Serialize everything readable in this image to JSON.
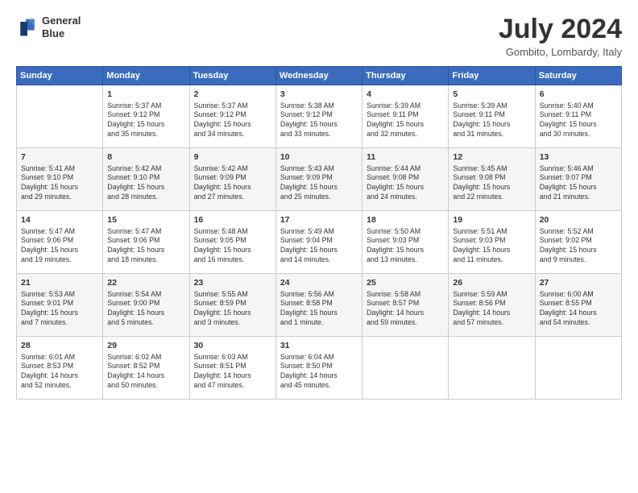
{
  "header": {
    "logo_line1": "General",
    "logo_line2": "Blue",
    "month_year": "July 2024",
    "location": "Gombito, Lombardy, Italy"
  },
  "weekdays": [
    "Sunday",
    "Monday",
    "Tuesday",
    "Wednesday",
    "Thursday",
    "Friday",
    "Saturday"
  ],
  "weeks": [
    [
      {
        "day": "",
        "info": ""
      },
      {
        "day": "1",
        "info": "Sunrise: 5:37 AM\nSunset: 9:12 PM\nDaylight: 15 hours\nand 35 minutes."
      },
      {
        "day": "2",
        "info": "Sunrise: 5:37 AM\nSunset: 9:12 PM\nDaylight: 15 hours\nand 34 minutes."
      },
      {
        "day": "3",
        "info": "Sunrise: 5:38 AM\nSunset: 9:12 PM\nDaylight: 15 hours\nand 33 minutes."
      },
      {
        "day": "4",
        "info": "Sunrise: 5:39 AM\nSunset: 9:11 PM\nDaylight: 15 hours\nand 32 minutes."
      },
      {
        "day": "5",
        "info": "Sunrise: 5:39 AM\nSunset: 9:11 PM\nDaylight: 15 hours\nand 31 minutes."
      },
      {
        "day": "6",
        "info": "Sunrise: 5:40 AM\nSunset: 9:11 PM\nDaylight: 15 hours\nand 30 minutes."
      }
    ],
    [
      {
        "day": "7",
        "info": "Sunrise: 5:41 AM\nSunset: 9:10 PM\nDaylight: 15 hours\nand 29 minutes."
      },
      {
        "day": "8",
        "info": "Sunrise: 5:42 AM\nSunset: 9:10 PM\nDaylight: 15 hours\nand 28 minutes."
      },
      {
        "day": "9",
        "info": "Sunrise: 5:42 AM\nSunset: 9:09 PM\nDaylight: 15 hours\nand 27 minutes."
      },
      {
        "day": "10",
        "info": "Sunrise: 5:43 AM\nSunset: 9:09 PM\nDaylight: 15 hours\nand 25 minutes."
      },
      {
        "day": "11",
        "info": "Sunrise: 5:44 AM\nSunset: 9:08 PM\nDaylight: 15 hours\nand 24 minutes."
      },
      {
        "day": "12",
        "info": "Sunrise: 5:45 AM\nSunset: 9:08 PM\nDaylight: 15 hours\nand 22 minutes."
      },
      {
        "day": "13",
        "info": "Sunrise: 5:46 AM\nSunset: 9:07 PM\nDaylight: 15 hours\nand 21 minutes."
      }
    ],
    [
      {
        "day": "14",
        "info": "Sunrise: 5:47 AM\nSunset: 9:06 PM\nDaylight: 15 hours\nand 19 minutes."
      },
      {
        "day": "15",
        "info": "Sunrise: 5:47 AM\nSunset: 9:06 PM\nDaylight: 15 hours\nand 18 minutes."
      },
      {
        "day": "16",
        "info": "Sunrise: 5:48 AM\nSunset: 9:05 PM\nDaylight: 15 hours\nand 16 minutes."
      },
      {
        "day": "17",
        "info": "Sunrise: 5:49 AM\nSunset: 9:04 PM\nDaylight: 15 hours\nand 14 minutes."
      },
      {
        "day": "18",
        "info": "Sunrise: 5:50 AM\nSunset: 9:03 PM\nDaylight: 15 hours\nand 13 minutes."
      },
      {
        "day": "19",
        "info": "Sunrise: 5:51 AM\nSunset: 9:03 PM\nDaylight: 15 hours\nand 11 minutes."
      },
      {
        "day": "20",
        "info": "Sunrise: 5:52 AM\nSunset: 9:02 PM\nDaylight: 15 hours\nand 9 minutes."
      }
    ],
    [
      {
        "day": "21",
        "info": "Sunrise: 5:53 AM\nSunset: 9:01 PM\nDaylight: 15 hours\nand 7 minutes."
      },
      {
        "day": "22",
        "info": "Sunrise: 5:54 AM\nSunset: 9:00 PM\nDaylight: 15 hours\nand 5 minutes."
      },
      {
        "day": "23",
        "info": "Sunrise: 5:55 AM\nSunset: 8:59 PM\nDaylight: 15 hours\nand 3 minutes."
      },
      {
        "day": "24",
        "info": "Sunrise: 5:56 AM\nSunset: 8:58 PM\nDaylight: 15 hours\nand 1 minute."
      },
      {
        "day": "25",
        "info": "Sunrise: 5:58 AM\nSunset: 8:57 PM\nDaylight: 14 hours\nand 59 minutes."
      },
      {
        "day": "26",
        "info": "Sunrise: 5:59 AM\nSunset: 8:56 PM\nDaylight: 14 hours\nand 57 minutes."
      },
      {
        "day": "27",
        "info": "Sunrise: 6:00 AM\nSunset: 8:55 PM\nDaylight: 14 hours\nand 54 minutes."
      }
    ],
    [
      {
        "day": "28",
        "info": "Sunrise: 6:01 AM\nSunset: 8:53 PM\nDaylight: 14 hours\nand 52 minutes."
      },
      {
        "day": "29",
        "info": "Sunrise: 6:02 AM\nSunset: 8:52 PM\nDaylight: 14 hours\nand 50 minutes."
      },
      {
        "day": "30",
        "info": "Sunrise: 6:03 AM\nSunset: 8:51 PM\nDaylight: 14 hours\nand 47 minutes."
      },
      {
        "day": "31",
        "info": "Sunrise: 6:04 AM\nSunset: 8:50 PM\nDaylight: 14 hours\nand 45 minutes."
      },
      {
        "day": "",
        "info": ""
      },
      {
        "day": "",
        "info": ""
      },
      {
        "day": "",
        "info": ""
      }
    ]
  ]
}
